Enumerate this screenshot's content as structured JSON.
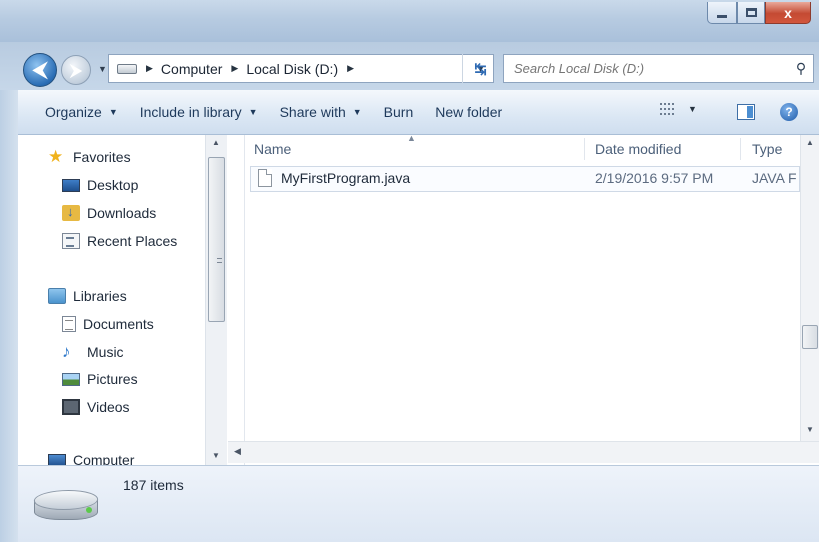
{
  "window": {
    "minimize_label": "",
    "close_label": "x"
  },
  "address": {
    "crumbs": [
      {
        "label": "Computer"
      },
      {
        "label": "Local Disk (D:)"
      }
    ]
  },
  "search": {
    "placeholder": "Search Local Disk (D:)"
  },
  "toolbar": {
    "organize": "Organize",
    "include_in_library": "Include in library",
    "share_with": "Share with",
    "burn": "Burn",
    "new_folder": "New folder"
  },
  "nav": {
    "favorites": {
      "label": "Favorites",
      "items": [
        {
          "label": "Desktop",
          "icon": "desktop-icon"
        },
        {
          "label": "Downloads",
          "icon": "downloads-icon"
        },
        {
          "label": "Recent Places",
          "icon": "recent-places-icon"
        }
      ]
    },
    "libraries": {
      "label": "Libraries",
      "items": [
        {
          "label": "Documents",
          "icon": "documents-icon"
        },
        {
          "label": "Music",
          "icon": "music-icon"
        },
        {
          "label": "Pictures",
          "icon": "pictures-icon"
        },
        {
          "label": "Videos",
          "icon": "videos-icon"
        }
      ]
    },
    "computer": {
      "label": "Computer"
    }
  },
  "columns": {
    "name": "Name",
    "date_modified": "Date modified",
    "type": "Type"
  },
  "files": [
    {
      "name": "MyFirstProgram.java",
      "date_modified": "2/19/2016 9:57 PM",
      "type": "JAVA F"
    }
  ],
  "details": {
    "item_count": "187 items"
  },
  "colors": {
    "accent": "#2a6db5",
    "close_button": "#c44a33",
    "favorites_star": "#f0b21c"
  }
}
